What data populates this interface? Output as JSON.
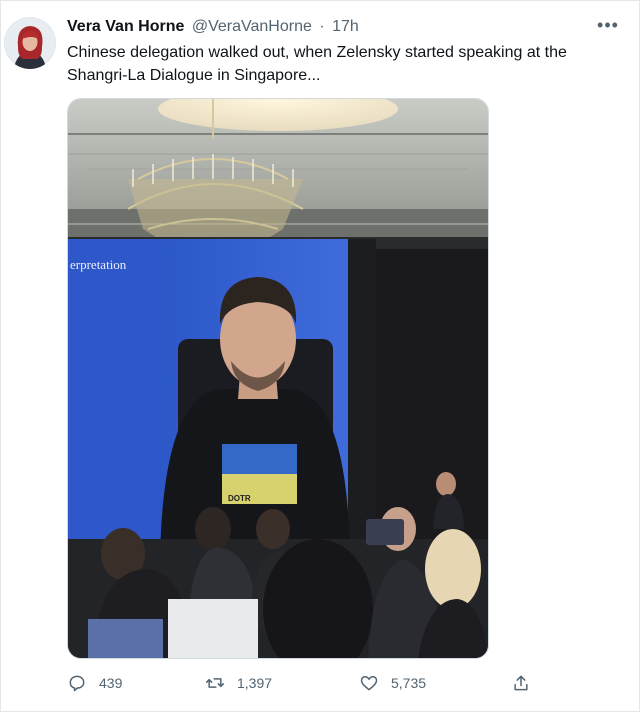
{
  "author": {
    "display_name": "Vera Van Horne",
    "handle": "@VeraVanHorne",
    "separator": "·",
    "timestamp": "17h"
  },
  "tweet": {
    "text": "Chinese delegation walked out, when Zelensky started speaking at the Shangri-La Dialogue in Singapore...",
    "more_label": "•••"
  },
  "media": {
    "screen_text": "erpretation",
    "shirt_text": "DOTR"
  },
  "actions": {
    "reply_count": "439",
    "retweet_count": "1,397",
    "like_count": "5,735"
  },
  "icons": [
    "more-icon",
    "reply-icon",
    "retweet-icon",
    "like-icon",
    "share-icon"
  ],
  "colors": {
    "secondary_text": "#536471",
    "primary_text": "#0f1419",
    "stage_blue": "#2f5fd0"
  }
}
